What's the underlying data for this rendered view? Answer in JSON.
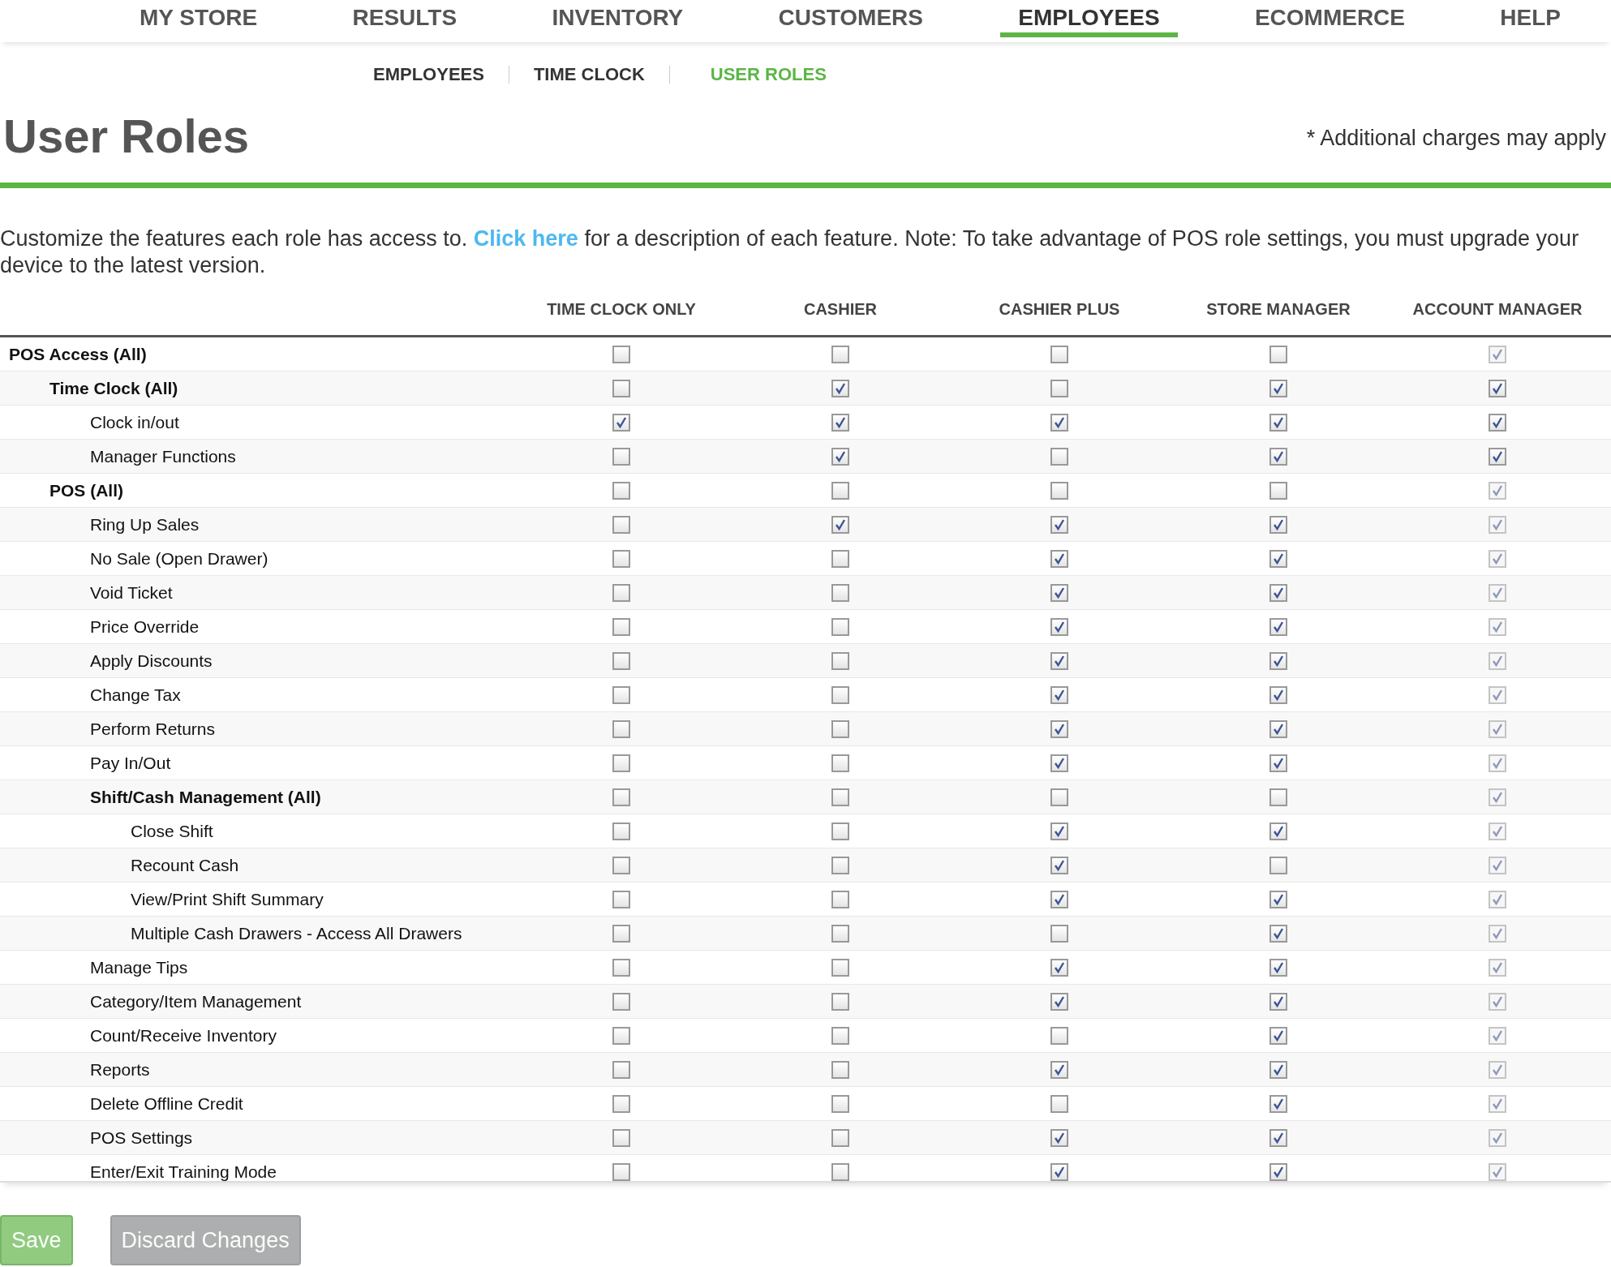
{
  "nav": [
    {
      "label": "MY STORE",
      "selected": false
    },
    {
      "label": "RESULTS",
      "selected": false
    },
    {
      "label": "INVENTORY",
      "selected": false
    },
    {
      "label": "CUSTOMERS",
      "selected": false
    },
    {
      "label": "EMPLOYEES",
      "selected": true
    },
    {
      "label": "ECOMMERCE",
      "selected": false
    },
    {
      "label": "HELP",
      "selected": false
    }
  ],
  "subnav": [
    {
      "label": "EMPLOYEES",
      "selected": false
    },
    {
      "label": "TIME CLOCK",
      "selected": false
    },
    {
      "label": "USER ROLES",
      "selected": true
    }
  ],
  "title": "User Roles",
  "note": "* Additional charges may apply",
  "description": {
    "before": "Customize the features each role has access to.",
    "link": "Click here",
    "after": "for a description of each feature. Note: To take advantage of POS role settings, you must upgrade your device to the latest version."
  },
  "columns": [
    "TIME CLOCK ONLY",
    "CASHIER",
    "CASHIER PLUS",
    "STORE MANAGER",
    "ACCOUNT MANAGER"
  ],
  "rows": [
    {
      "label": "POS Access (All)",
      "checks": [
        {
          "checked": false,
          "disabled": false
        },
        {
          "checked": false,
          "disabled": false
        },
        {
          "checked": false,
          "disabled": false
        },
        {
          "checked": false,
          "disabled": false
        },
        {
          "checked": true,
          "disabled": true
        }
      ],
      "children": [
        {
          "label": "Time Clock (All)",
          "checks": [
            {
              "checked": false,
              "disabled": false
            },
            {
              "checked": true,
              "disabled": false
            },
            {
              "checked": false,
              "disabled": false
            },
            {
              "checked": true,
              "disabled": false
            },
            {
              "checked": true,
              "disabled": false
            }
          ],
          "children": [
            {
              "label": "Clock in/out",
              "checks": [
                {
                  "checked": true,
                  "disabled": false
                },
                {
                  "checked": true,
                  "disabled": false
                },
                {
                  "checked": true,
                  "disabled": false
                },
                {
                  "checked": true,
                  "disabled": false
                },
                {
                  "checked": true,
                  "disabled": false
                }
              ]
            },
            {
              "label": "Manager Functions",
              "checks": [
                {
                  "checked": false,
                  "disabled": false
                },
                {
                  "checked": true,
                  "disabled": false
                },
                {
                  "checked": false,
                  "disabled": false
                },
                {
                  "checked": true,
                  "disabled": false
                },
                {
                  "checked": true,
                  "disabled": false
                }
              ]
            }
          ]
        },
        {
          "label": "POS (All)",
          "checks": [
            {
              "checked": false,
              "disabled": false
            },
            {
              "checked": false,
              "disabled": false
            },
            {
              "checked": false,
              "disabled": false
            },
            {
              "checked": false,
              "disabled": false
            },
            {
              "checked": true,
              "disabled": true
            }
          ],
          "children": [
            {
              "label": "Ring Up Sales",
              "checks": [
                {
                  "checked": false,
                  "disabled": false
                },
                {
                  "checked": true,
                  "disabled": false
                },
                {
                  "checked": true,
                  "disabled": false
                },
                {
                  "checked": true,
                  "disabled": false
                },
                {
                  "checked": true,
                  "disabled": true
                }
              ]
            },
            {
              "label": "No Sale (Open Drawer)",
              "checks": [
                {
                  "checked": false,
                  "disabled": false
                },
                {
                  "checked": false,
                  "disabled": false
                },
                {
                  "checked": true,
                  "disabled": false
                },
                {
                  "checked": true,
                  "disabled": false
                },
                {
                  "checked": true,
                  "disabled": true
                }
              ]
            },
            {
              "label": "Void Ticket",
              "checks": [
                {
                  "checked": false,
                  "disabled": false
                },
                {
                  "checked": false,
                  "disabled": false
                },
                {
                  "checked": true,
                  "disabled": false
                },
                {
                  "checked": true,
                  "disabled": false
                },
                {
                  "checked": true,
                  "disabled": true
                }
              ]
            },
            {
              "label": "Price Override",
              "checks": [
                {
                  "checked": false,
                  "disabled": false
                },
                {
                  "checked": false,
                  "disabled": false
                },
                {
                  "checked": true,
                  "disabled": false
                },
                {
                  "checked": true,
                  "disabled": false
                },
                {
                  "checked": true,
                  "disabled": true
                }
              ]
            },
            {
              "label": "Apply Discounts",
              "checks": [
                {
                  "checked": false,
                  "disabled": false
                },
                {
                  "checked": false,
                  "disabled": false
                },
                {
                  "checked": true,
                  "disabled": false
                },
                {
                  "checked": true,
                  "disabled": false
                },
                {
                  "checked": true,
                  "disabled": true
                }
              ]
            },
            {
              "label": "Change Tax",
              "checks": [
                {
                  "checked": false,
                  "disabled": false
                },
                {
                  "checked": false,
                  "disabled": false
                },
                {
                  "checked": true,
                  "disabled": false
                },
                {
                  "checked": true,
                  "disabled": false
                },
                {
                  "checked": true,
                  "disabled": true
                }
              ]
            },
            {
              "label": "Perform Returns",
              "checks": [
                {
                  "checked": false,
                  "disabled": false
                },
                {
                  "checked": false,
                  "disabled": false
                },
                {
                  "checked": true,
                  "disabled": false
                },
                {
                  "checked": true,
                  "disabled": false
                },
                {
                  "checked": true,
                  "disabled": true
                }
              ]
            },
            {
              "label": "Pay In/Out",
              "checks": [
                {
                  "checked": false,
                  "disabled": false
                },
                {
                  "checked": false,
                  "disabled": false
                },
                {
                  "checked": true,
                  "disabled": false
                },
                {
                  "checked": true,
                  "disabled": false
                },
                {
                  "checked": true,
                  "disabled": true
                }
              ]
            },
            {
              "label": "Shift/Cash Management (All)",
              "checks": [
                {
                  "checked": false,
                  "disabled": false
                },
                {
                  "checked": false,
                  "disabled": false
                },
                {
                  "checked": false,
                  "disabled": false
                },
                {
                  "checked": false,
                  "disabled": false
                },
                {
                  "checked": true,
                  "disabled": true
                }
              ],
              "children": [
                {
                  "label": "Close Shift",
                  "checks": [
                    {
                      "checked": false,
                      "disabled": false
                    },
                    {
                      "checked": false,
                      "disabled": false
                    },
                    {
                      "checked": true,
                      "disabled": false
                    },
                    {
                      "checked": true,
                      "disabled": false
                    },
                    {
                      "checked": true,
                      "disabled": true
                    }
                  ]
                },
                {
                  "label": "Recount Cash",
                  "checks": [
                    {
                      "checked": false,
                      "disabled": false
                    },
                    {
                      "checked": false,
                      "disabled": false
                    },
                    {
                      "checked": true,
                      "disabled": false
                    },
                    {
                      "checked": false,
                      "disabled": false
                    },
                    {
                      "checked": true,
                      "disabled": true
                    }
                  ]
                },
                {
                  "label": "View/Print Shift Summary",
                  "checks": [
                    {
                      "checked": false,
                      "disabled": false
                    },
                    {
                      "checked": false,
                      "disabled": false
                    },
                    {
                      "checked": true,
                      "disabled": false
                    },
                    {
                      "checked": true,
                      "disabled": false
                    },
                    {
                      "checked": true,
                      "disabled": true
                    }
                  ]
                },
                {
                  "label": "Multiple Cash Drawers - Access All Drawers",
                  "checks": [
                    {
                      "checked": false,
                      "disabled": false
                    },
                    {
                      "checked": false,
                      "disabled": false
                    },
                    {
                      "checked": false,
                      "disabled": false
                    },
                    {
                      "checked": true,
                      "disabled": false
                    },
                    {
                      "checked": true,
                      "disabled": true
                    }
                  ]
                }
              ]
            },
            {
              "label": "Manage Tips",
              "checks": [
                {
                  "checked": false,
                  "disabled": false
                },
                {
                  "checked": false,
                  "disabled": false
                },
                {
                  "checked": true,
                  "disabled": false
                },
                {
                  "checked": true,
                  "disabled": false
                },
                {
                  "checked": true,
                  "disabled": true
                }
              ]
            },
            {
              "label": "Category/Item Management",
              "checks": [
                {
                  "checked": false,
                  "disabled": false
                },
                {
                  "checked": false,
                  "disabled": false
                },
                {
                  "checked": true,
                  "disabled": false
                },
                {
                  "checked": true,
                  "disabled": false
                },
                {
                  "checked": true,
                  "disabled": true
                }
              ]
            },
            {
              "label": "Count/Receive Inventory",
              "checks": [
                {
                  "checked": false,
                  "disabled": false
                },
                {
                  "checked": false,
                  "disabled": false
                },
                {
                  "checked": false,
                  "disabled": false
                },
                {
                  "checked": true,
                  "disabled": false
                },
                {
                  "checked": true,
                  "disabled": true
                }
              ]
            },
            {
              "label": "Reports",
              "checks": [
                {
                  "checked": false,
                  "disabled": false
                },
                {
                  "checked": false,
                  "disabled": false
                },
                {
                  "checked": true,
                  "disabled": false
                },
                {
                  "checked": true,
                  "disabled": false
                },
                {
                  "checked": true,
                  "disabled": true
                }
              ]
            },
            {
              "label": "Delete Offline Credit",
              "checks": [
                {
                  "checked": false,
                  "disabled": false
                },
                {
                  "checked": false,
                  "disabled": false
                },
                {
                  "checked": false,
                  "disabled": false
                },
                {
                  "checked": true,
                  "disabled": false
                },
                {
                  "checked": true,
                  "disabled": true
                }
              ]
            },
            {
              "label": "POS Settings",
              "checks": [
                {
                  "checked": false,
                  "disabled": false
                },
                {
                  "checked": false,
                  "disabled": false
                },
                {
                  "checked": true,
                  "disabled": false
                },
                {
                  "checked": true,
                  "disabled": false
                },
                {
                  "checked": true,
                  "disabled": true
                }
              ]
            },
            {
              "label": "Enter/Exit Training Mode",
              "checks": [
                {
                  "checked": false,
                  "disabled": false
                },
                {
                  "checked": false,
                  "disabled": false
                },
                {
                  "checked": true,
                  "disabled": false
                },
                {
                  "checked": true,
                  "disabled": false
                },
                {
                  "checked": true,
                  "disabled": true
                }
              ]
            }
          ]
        }
      ]
    }
  ],
  "buttons": [
    {
      "label": "Save",
      "kind": "primary",
      "disabled": true
    },
    {
      "label": "Discard Changes",
      "kind": "secondary",
      "disabled": true
    }
  ]
}
